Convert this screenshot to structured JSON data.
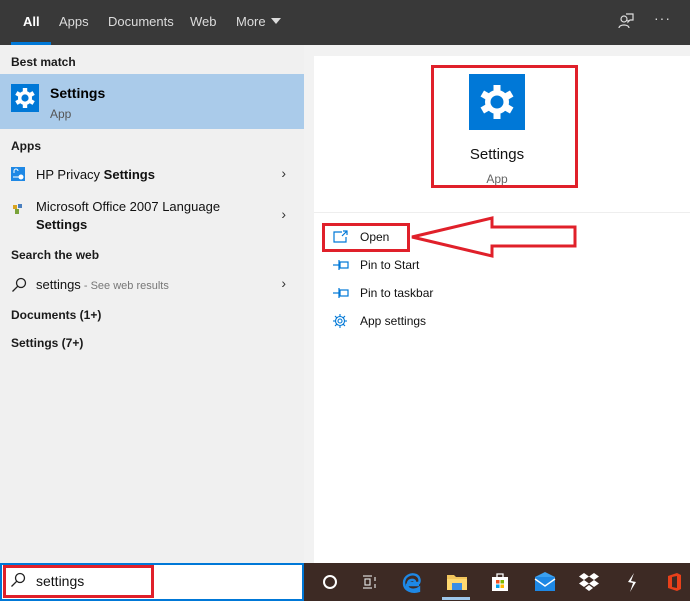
{
  "topbar": {
    "tabs": [
      {
        "label": "All",
        "active": true
      },
      {
        "label": "Apps",
        "active": false
      },
      {
        "label": "Documents",
        "active": false
      },
      {
        "label": "Web",
        "active": false
      },
      {
        "label": "More",
        "active": false
      }
    ],
    "icons": [
      "feedback-icon",
      "more-options-icon"
    ],
    "more_options_glyph": "···",
    "accent": "#0078d7"
  },
  "left": {
    "best_match_header": "Best match",
    "best_match": {
      "title": "Settings",
      "subtitle": "App",
      "icon": "gear-icon"
    },
    "apps_header": "Apps",
    "apps": [
      {
        "prefix": "HP Privacy ",
        "bold": "Settings",
        "icon": "hp-privacy-icon"
      },
      {
        "prefix": "Microsoft Office 2007 Language",
        "bold": "Settings",
        "icon": "office-language-icon"
      }
    ],
    "web_header": "Search the web",
    "web": {
      "query": "settings",
      "suffix": " - See web results",
      "icon": "search-icon"
    },
    "documents_header": "Documents (1+)",
    "settings_header": "Settings (7+)",
    "chevron": "›"
  },
  "right": {
    "title": "Settings",
    "subtitle": "App",
    "actions": [
      {
        "label": "Open",
        "icon": "open-icon"
      },
      {
        "label": "Pin to Start",
        "icon": "pin-icon"
      },
      {
        "label": "Pin to taskbar",
        "icon": "pin-icon"
      },
      {
        "label": "App settings",
        "icon": "gear-outline-icon"
      }
    ],
    "annotation_color": "#e0202a"
  },
  "search": {
    "value": "settings",
    "placeholder": ""
  },
  "taskbar": {
    "items": [
      "cortana",
      "task-view",
      "edge",
      "file-explorer",
      "store",
      "mail",
      "dropbox",
      "app-bolt",
      "office"
    ]
  }
}
